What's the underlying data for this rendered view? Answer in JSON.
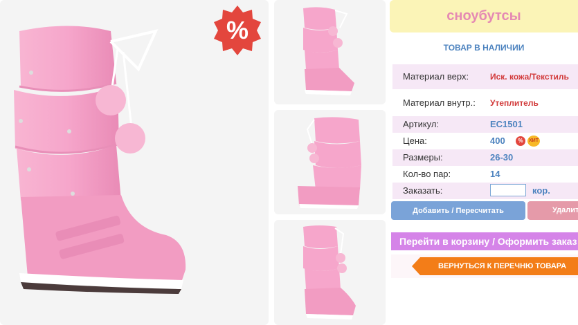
{
  "product": {
    "title": "сноубутсы",
    "stock_status": "ТОВАР В НАЛИЧИИ",
    "sale_symbol": "%",
    "specs": [
      {
        "label": "Материал верх:",
        "value": "Иск. кожа/Текстиль"
      },
      {
        "label": "Материал внутр.:",
        "value": "Утеплитель"
      },
      {
        "label": "Артикул:",
        "value": "EC1501"
      },
      {
        "label": "Цена:",
        "value": "400"
      },
      {
        "label": "Размеры:",
        "value": "26-30"
      },
      {
        "label": "Кол-во пар:",
        "value": "14"
      }
    ],
    "badge_percent": "%",
    "badge_hit": "ХИТ"
  },
  "order": {
    "label": "Заказать:",
    "quantity_value": "",
    "unit": "кор."
  },
  "buttons": {
    "add": "Добавить / Пересчитать",
    "delete": "Удалить",
    "cart": "Перейти в корзину / Оформить заказ",
    "back": "ВЕРНУТЬСЯ К ПЕРЕЧНЮ ТОВАРА"
  },
  "colors": {
    "boot_pink": "#f4a3c8",
    "title_bg": "#fbf4b7",
    "accent_blue": "#4d83bf",
    "sale_red": "#e3463d",
    "back_orange": "#f37d18"
  },
  "icons": [
    "sale-percent-badge",
    "discount-icon",
    "hit-icon"
  ]
}
